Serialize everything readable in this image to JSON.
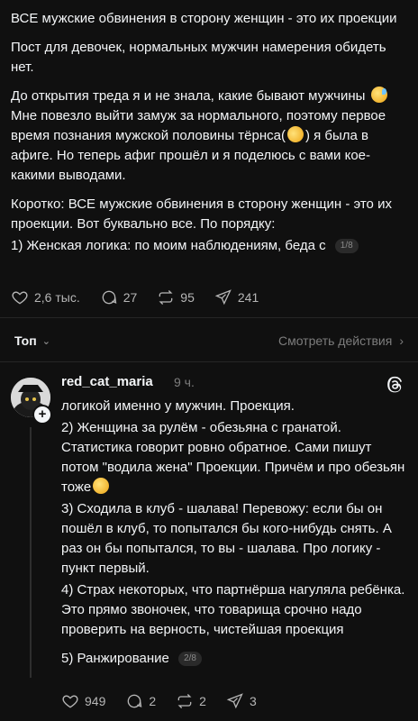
{
  "post": {
    "title": "ВСЕ мужские обвинения в сторону женщин - это их проекции",
    "p1": "Пост для девочек, нормальных мужчин намерения обидеть нет.",
    "p2a": "До открытия треда я и не знала, какие бывают мужчины",
    "p2b": "Мне повезло выйти замуж за нормального, поэтому первое время познания мужской половины тёрнса(",
    "p2c": ") я была в афиге. Но теперь афиг прошёл и я поделюсь с вами кое-какими выводами.",
    "p3": "Коротко: ВСЕ мужские обвинения в сторону женщин - это их проекции. Вот буквально все. По порядку:",
    "p4": "1) Женская логика: по моим наблюдениям, беда с",
    "pager": "1/8",
    "likes": "2,6 тыс.",
    "comments": "27",
    "reposts": "95",
    "shares": "241"
  },
  "replies_bar": {
    "sort_label": "Топ",
    "view_activity": "Смотреть действия"
  },
  "reply": {
    "username": "red_cat_maria",
    "time": "9 ч.",
    "l1": "логикой именно у мужчин. Проекция.",
    "l2a": "2) Женщина за рулём - обезьяна с гранатой. Статистика говорит ровно обратное. Сами пишут потом \"водила жена\" Проекции. Причём и про обезьян тоже",
    "l3": "3) Сходила в клуб - шалава! Перевожу: если бы он пошёл в клуб, то попытался бы кого-нибудь снять. А раз он бы попытался, то вы - шалава. Про логику - пункт первый.",
    "l4": "4) Страх некоторых, что партнёрша нагуляла ребёнка. Это прямо звоночек, что товарища срочно надо проверить на верность, чистейшая проекция",
    "l5": "5) Ранжирование",
    "pager": "2/8",
    "likes": "949",
    "comments": "2",
    "reposts": "2",
    "shares": "3"
  }
}
